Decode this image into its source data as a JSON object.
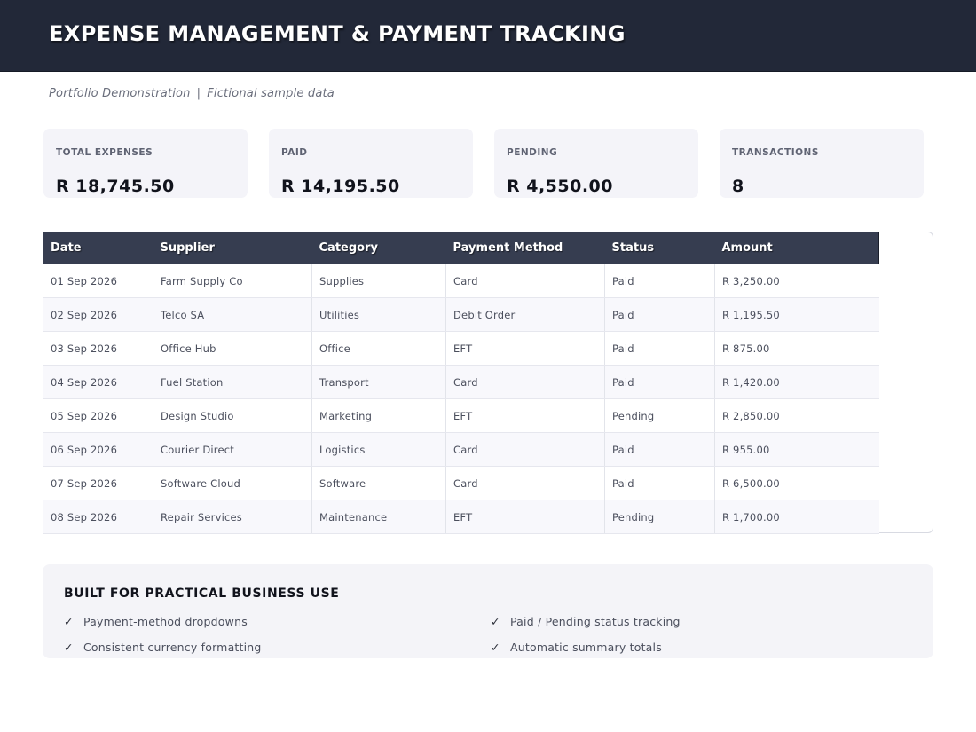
{
  "header": {
    "title": "EXPENSE MANAGEMENT & PAYMENT TRACKING"
  },
  "subtitle": {
    "left": "Portfolio Demonstration",
    "separator": "|",
    "right": "Fictional sample data"
  },
  "cards": [
    {
      "label": "TOTAL EXPENSES",
      "value": "R 18,745.50"
    },
    {
      "label": "PAID",
      "value": "R 14,195.50"
    },
    {
      "label": "PENDING",
      "value": "R 4,550.00"
    },
    {
      "label": "TRANSACTIONS",
      "value": "8"
    }
  ],
  "table": {
    "columns": [
      "Date",
      "Supplier",
      "Category",
      "Payment Method",
      "Status",
      "Amount"
    ],
    "rows": [
      [
        "01 Sep 2026",
        "Farm Supply Co",
        "Supplies",
        "Card",
        "Paid",
        "R 3,250.00"
      ],
      [
        "02 Sep 2026",
        "Telco SA",
        "Utilities",
        "Debit Order",
        "Paid",
        "R 1,195.50"
      ],
      [
        "03 Sep 2026",
        "Office Hub",
        "Office",
        "EFT",
        "Paid",
        "R 875.00"
      ],
      [
        "04 Sep 2026",
        "Fuel Station",
        "Transport",
        "Card",
        "Paid",
        "R 1,420.00"
      ],
      [
        "05 Sep 2026",
        "Design Studio",
        "Marketing",
        "EFT",
        "Pending",
        "R 2,850.00"
      ],
      [
        "06 Sep 2026",
        "Courier Direct",
        "Logistics",
        "Card",
        "Paid",
        "R 955.00"
      ],
      [
        "07 Sep 2026",
        "Software Cloud",
        "Software",
        "Card",
        "Paid",
        "R 6,500.00"
      ],
      [
        "08 Sep 2026",
        "Repair Services",
        "Maintenance",
        "EFT",
        "Pending",
        "R 1,700.00"
      ]
    ]
  },
  "features": {
    "title": "BUILT FOR PRACTICAL BUSINESS USE",
    "check_glyph": "✓",
    "items": [
      "Payment-method dropdowns",
      "Paid / Pending status tracking",
      "Consistent currency formatting",
      "Automatic summary totals"
    ]
  }
}
